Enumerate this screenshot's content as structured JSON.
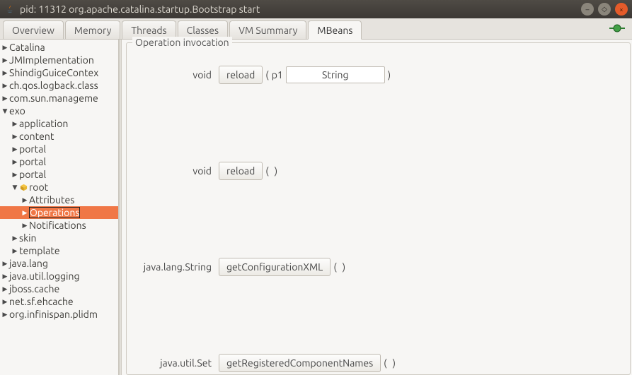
{
  "window": {
    "title": "pid: 11312 org.apache.catalina.startup.Bootstrap start"
  },
  "tabs": {
    "t0": "Overview",
    "t1": "Memory",
    "t2": "Threads",
    "t3": "Classes",
    "t4": "VM Summary",
    "t5": "MBeans"
  },
  "tree": {
    "n0": "Catalina",
    "n1": "JMImplementation",
    "n2": "ShindigGuiceContex",
    "n3": "ch.qos.logback.class",
    "n4": "com.sun.manageme",
    "n5": "exo",
    "n5_0": "application",
    "n5_1": "content",
    "n5_2": "portal",
    "n5_3": "portal",
    "n5_4": "portal",
    "n5_5": "root",
    "n5_5_0": "Attributes",
    "n5_5_1": "Operations",
    "n5_5_2": "Notifications",
    "n5_6": "skin",
    "n5_7": "template",
    "n6": "java.lang",
    "n7": "java.util.logging",
    "n8": "jboss.cache",
    "n9": "net.sf.ehcache",
    "n10": "org.infinispan.plidm"
  },
  "panel": {
    "title": "Operation invocation",
    "ops": {
      "r0_ret": "void",
      "r0_btn": "reload",
      "r0_p1_name": "p1",
      "r0_p1_value": "String",
      "r1_ret": "void",
      "r1_btn": "reload",
      "r2_ret": "java.lang.String",
      "r2_btn": "getConfigurationXML",
      "r3_ret": "java.util.Set",
      "r3_btn": "getRegisteredComponentNames"
    }
  }
}
